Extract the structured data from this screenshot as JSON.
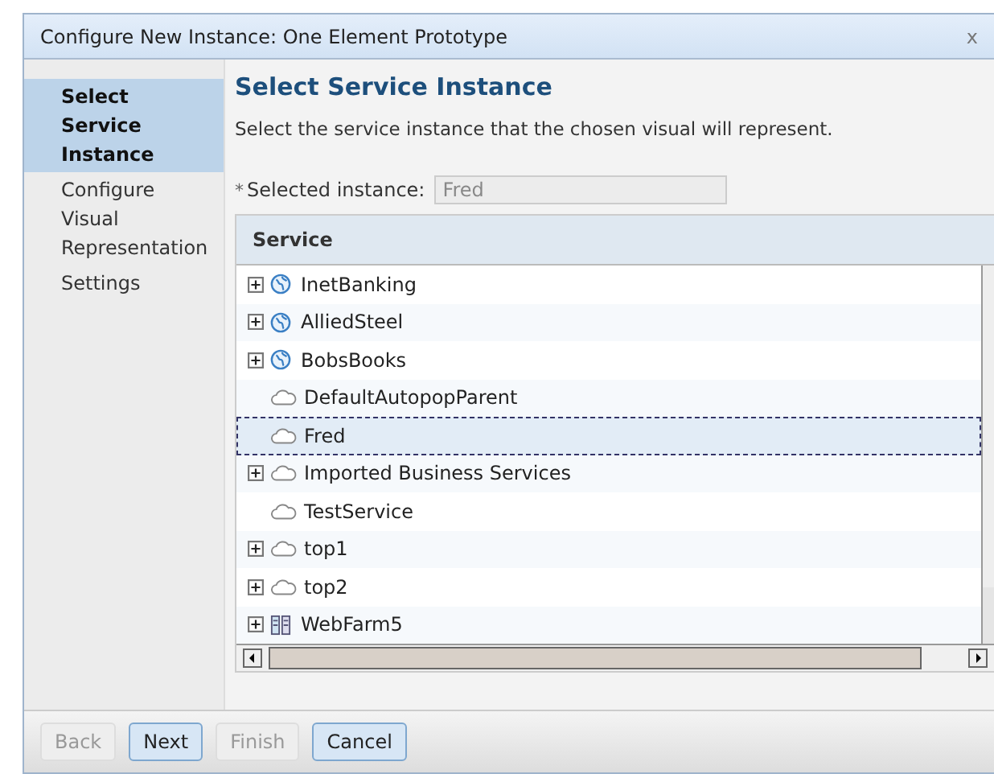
{
  "window": {
    "title": "Configure New Instance: One Element Prototype",
    "close": "x"
  },
  "steps": [
    {
      "label": "Select Service Instance",
      "selected": true
    },
    {
      "label": "Configure Visual Representation",
      "selected": false
    },
    {
      "label": "Settings",
      "selected": false
    }
  ],
  "heading": "Select Service Instance",
  "description": "Select the service instance that the chosen visual will represent.",
  "selected_instance": {
    "required_mark": "*",
    "label": "Selected instance:",
    "value": "Fred"
  },
  "table": {
    "columns": [
      "Service"
    ],
    "rows": [
      {
        "name": "InetBanking",
        "kind": "globe",
        "expandable": true,
        "selected": false
      },
      {
        "name": "AlliedSteel",
        "kind": "globe",
        "expandable": true,
        "selected": false
      },
      {
        "name": "BobsBooks",
        "kind": "globe",
        "expandable": true,
        "selected": false
      },
      {
        "name": "DefaultAutopopParent",
        "kind": "cloud",
        "expandable": false,
        "selected": false
      },
      {
        "name": "Fred",
        "kind": "cloud",
        "expandable": false,
        "selected": true
      },
      {
        "name": "Imported Business Services",
        "kind": "cloud",
        "expandable": true,
        "selected": false
      },
      {
        "name": "TestService",
        "kind": "cloud",
        "expandable": false,
        "selected": false
      },
      {
        "name": "top1",
        "kind": "cloud",
        "expandable": true,
        "selected": false
      },
      {
        "name": "top2",
        "kind": "cloud",
        "expandable": true,
        "selected": false
      },
      {
        "name": "WebFarm5",
        "kind": "server",
        "expandable": true,
        "selected": false
      }
    ]
  },
  "buttons": [
    {
      "label": "Back",
      "disabled": true
    },
    {
      "label": "Next",
      "disabled": false
    },
    {
      "label": "Finish",
      "disabled": true
    },
    {
      "label": "Cancel",
      "disabled": false
    }
  ]
}
